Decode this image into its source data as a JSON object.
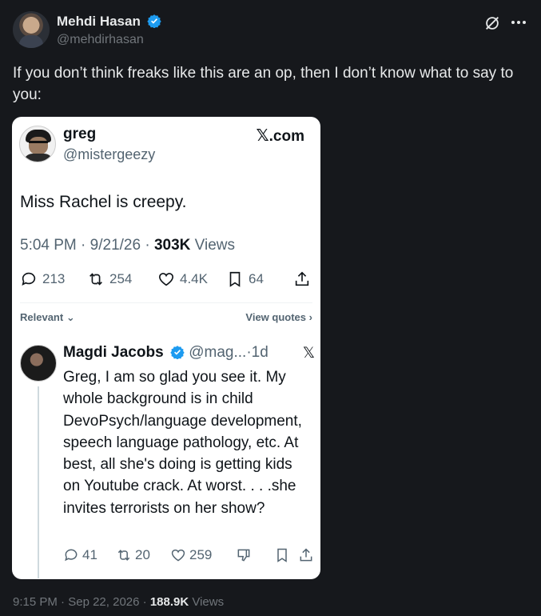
{
  "post": {
    "author_name": "Mehdi Hasan",
    "author_handle": "@mehdirhasan",
    "text": "If you don’t think freaks like this are an op, then I don’t know what to say to you:",
    "time": "9:15 PM",
    "date": "Sep 22, 2026",
    "views_count": "188.9K",
    "views_label": "Views",
    "sep": "·"
  },
  "card": {
    "author_name": "greg",
    "author_handle": "@mistergeezy",
    "site_label": ".com",
    "text": "Miss Rachel is creepy.",
    "time": "5:04 PM",
    "date": "9/21/26",
    "views_count": "303K",
    "views_label": "Views",
    "replies": "213",
    "reposts": "254",
    "likes": "4.4K",
    "bookmarks": "64",
    "sort_label": "Relevant",
    "view_quotes_label": "View quotes",
    "reply": {
      "author_name": "Magdi Jacobs",
      "author_handle": "@mag...",
      "age": "1d",
      "text": "Greg, I am so glad you see it. My whole background is in child DevoPsych/language development, speech language pathology, etc. At best, all she's doing is getting kids on Youtube crack. At worst. . . .she invites terrorists on her show?",
      "replies": "41",
      "reposts": "20",
      "likes": "259"
    }
  },
  "icons": [
    "verified-badge",
    "grok-icon",
    "more-icon",
    "x-logo",
    "reply-icon",
    "repost-icon",
    "like-icon",
    "bookmark-icon",
    "share-icon",
    "dislike-icon",
    "chevron-down-icon",
    "chevron-right-icon"
  ],
  "colors": {
    "background": "#16181c",
    "text": "#e7e9ea",
    "muted": "#71767b",
    "verified": "#1d9bf0",
    "card_bg": "#ffffff"
  }
}
